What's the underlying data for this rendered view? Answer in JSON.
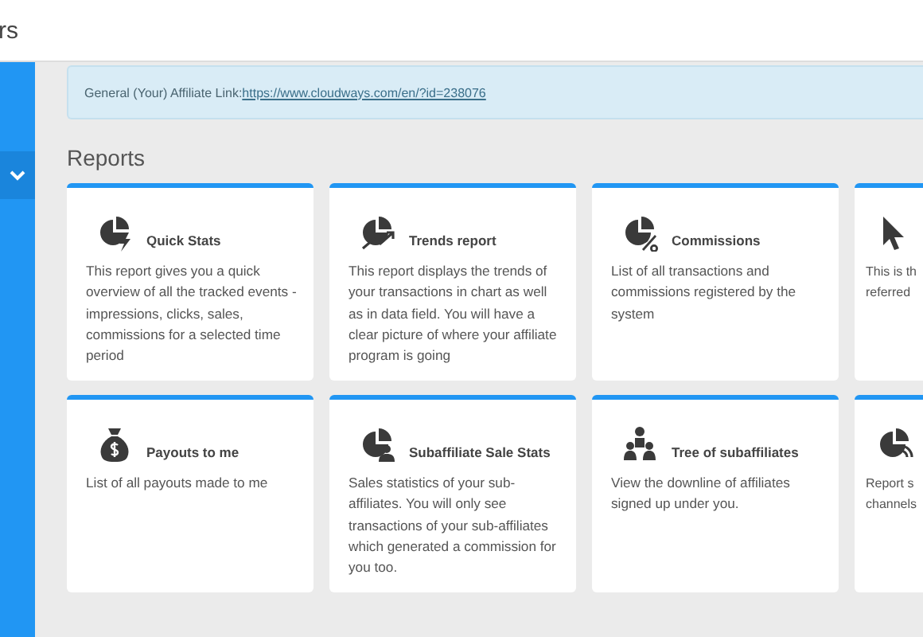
{
  "header": {
    "title": "rs"
  },
  "affiliate_link": {
    "label": "General (Your) Affiliate Link:",
    "url": "https://www.cloudways.com/en/?id=238076"
  },
  "section_title": "Reports",
  "cards": [
    {
      "title": "Quick Stats",
      "description": "This report gives you a quick overview of all the tracked events - impressions, clicks, sales, commissions for a selected time period"
    },
    {
      "title": "Trends report",
      "description": "This report displays the trends of your transactions in chart as well as in data field. You will have a clear picture of where your affiliate program is going"
    },
    {
      "title": "Commissions",
      "description": "List of all transactions and commissions registered by the system"
    },
    {
      "lines": [
        "This is th",
        "referred"
      ]
    },
    {
      "title": "Payouts to me",
      "description": "List of all payouts made to me"
    },
    {
      "title": "Subaffiliate Sale Stats",
      "description": "Sales statistics of your sub-affiliates. You will only see transactions of your sub-affiliates which generated a commission for you too."
    },
    {
      "title": "Tree of subaffiliates",
      "description": "View the downline of affiliates signed up under you."
    },
    {
      "lines": [
        "Report s",
        "channels"
      ]
    }
  ]
}
